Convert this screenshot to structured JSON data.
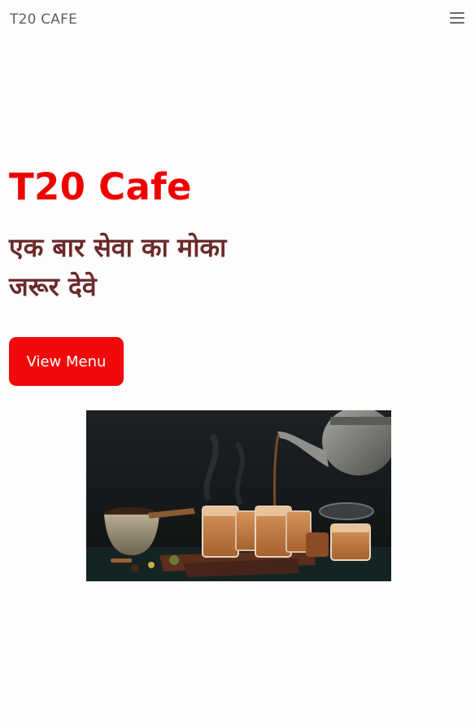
{
  "navbar": {
    "brand": "T20 CAFE",
    "menu_icon": "hamburger-menu-icon"
  },
  "hero": {
    "title": "T20 Cafe",
    "subtitle_line1": "एक बार सेवा का मोका",
    "subtitle_line2": "जरूर देवे",
    "cta_label": "View Menu",
    "image_subject": "masala chai being poured into glasses"
  },
  "colors": {
    "title": "#ee0000",
    "subtitle": "#6a2a2a",
    "button_bg": "#f20a0a",
    "button_text": "#ffffff",
    "brand_text": "#5f5f5f",
    "page_bg": "#fefcfc"
  }
}
